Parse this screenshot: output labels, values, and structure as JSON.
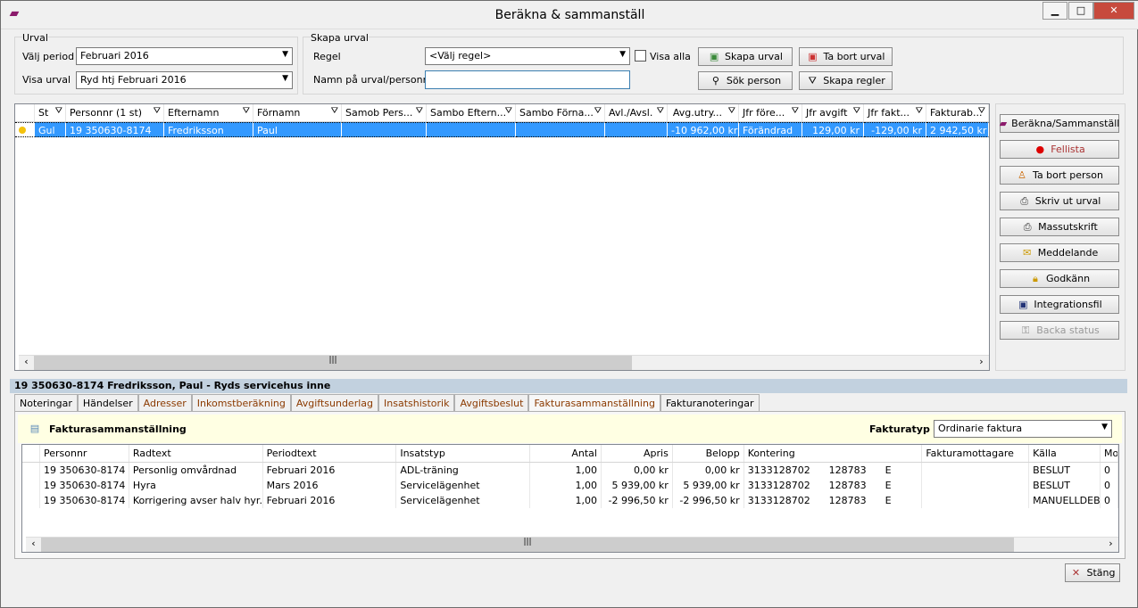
{
  "window": {
    "title": "Beräkna & sammanställ",
    "min": "▁",
    "max": "□",
    "close": "✕"
  },
  "urval": {
    "legend": "Urval",
    "period_label": "Välj period",
    "period_value": "Februari 2016",
    "visa_label": "Visa urval",
    "visa_value": "Ryd htj  Februari 2016"
  },
  "skapa": {
    "legend": "Skapa urval",
    "regel_label": "Regel",
    "regel_value": "<Välj regel>",
    "visa_alla": "Visa alla",
    "visa_alla_checked": false,
    "namn_label": "Namn på urval/personnr",
    "namn_value": "",
    "btn_skapa": "Skapa urval",
    "btn_tabort": "Ta bort urval",
    "btn_sok": "Sök person",
    "btn_regler": "Skapa regler"
  },
  "grid": {
    "columns": [
      "St",
      "Personnr (1 st)",
      "Efternamn",
      "Förnamn",
      "Samob Pers...",
      "Sambo Eftern...",
      "Sambo Förna...",
      "Avl./Avsl.",
      "Avg.utry...",
      "Jfr före...",
      "Jfr avgift",
      "Jfr fakt...",
      "Fakturab..."
    ],
    "rows": [
      [
        "Gul",
        "19 350630-8174",
        "Fredriksson",
        "Paul",
        "",
        "",
        "",
        "",
        "-10 962,00 kr",
        "Förändrad",
        "129,00 kr",
        "-129,00 kr",
        "2 942,50 kr"
      ]
    ],
    "status_color": "#f4c20d",
    "selected_color": "#3399ff"
  },
  "actions": [
    {
      "label": "Beräkna/Sammanställ",
      "icon": "book-icon",
      "enabled": true
    },
    {
      "label": "Fellista",
      "icon": "error-icon",
      "enabled": true
    },
    {
      "label": "Ta bort person",
      "icon": "remove-person-icon",
      "enabled": true
    },
    {
      "label": "Skriv ut urval",
      "icon": "printer-icon",
      "enabled": true
    },
    {
      "label": "Massutskrift",
      "icon": "printer-icon",
      "enabled": true
    },
    {
      "label": "Meddelande",
      "icon": "envelope-icon",
      "enabled": true
    },
    {
      "label": "Godkänn",
      "icon": "lock-icon",
      "enabled": true
    },
    {
      "label": "Integrationsfil",
      "icon": "file-export-icon",
      "enabled": true
    },
    {
      "label": "Backa status",
      "icon": "unlock-icon",
      "enabled": false
    }
  ],
  "person_header": "19 350630-8174 Fredriksson, Paul  -  Ryds servicehus inne",
  "tabs": [
    {
      "label": "Noteringar",
      "dark": true
    },
    {
      "label": "Händelser",
      "dark": true
    },
    {
      "label": "Adresser"
    },
    {
      "label": "Inkomstberäkning"
    },
    {
      "label": "Avgiftsunderlag"
    },
    {
      "label": "Insatshistorik"
    },
    {
      "label": "Avgiftsbeslut"
    },
    {
      "label": "Fakturasammanställning",
      "active": true
    },
    {
      "label": "Fakturanoteringar",
      "dark": true
    }
  ],
  "faktura": {
    "title": "Fakturasammanställning",
    "typ_label": "Fakturatyp",
    "typ_value": "Ordinarie faktura",
    "columns": [
      "Personnr",
      "Radtext",
      "Periodtext",
      "Insatstyp",
      "Antal",
      "Apris",
      "Belopp",
      "Kontering",
      "Fakturamottagare",
      "Källa",
      "Mo"
    ],
    "rows": [
      [
        "19 350630-8174",
        "Personlig omvårdnad",
        "Februari 2016",
        "ADL-träning",
        "1,00",
        "0,00 kr",
        "0,00 kr",
        "3133128702      128783      E",
        "",
        "BESLUT",
        "0"
      ],
      [
        "19 350630-8174",
        "Hyra",
        "Mars 2016",
        "Servicelägenhet",
        "1,00",
        "5 939,00 kr",
        "5 939,00 kr",
        "3133128702      128783      E",
        "",
        "BESLUT",
        "0"
      ],
      [
        "19 350630-8174",
        "Korrigering avser halv hyr...",
        "Februari 2016",
        "Servicelägenhet",
        "1,00",
        "-2 996,50 kr",
        "-2 996,50 kr",
        "3133128702      128783      E",
        "",
        "MANUELLDEB",
        "0"
      ]
    ]
  },
  "close_button": "Stäng"
}
